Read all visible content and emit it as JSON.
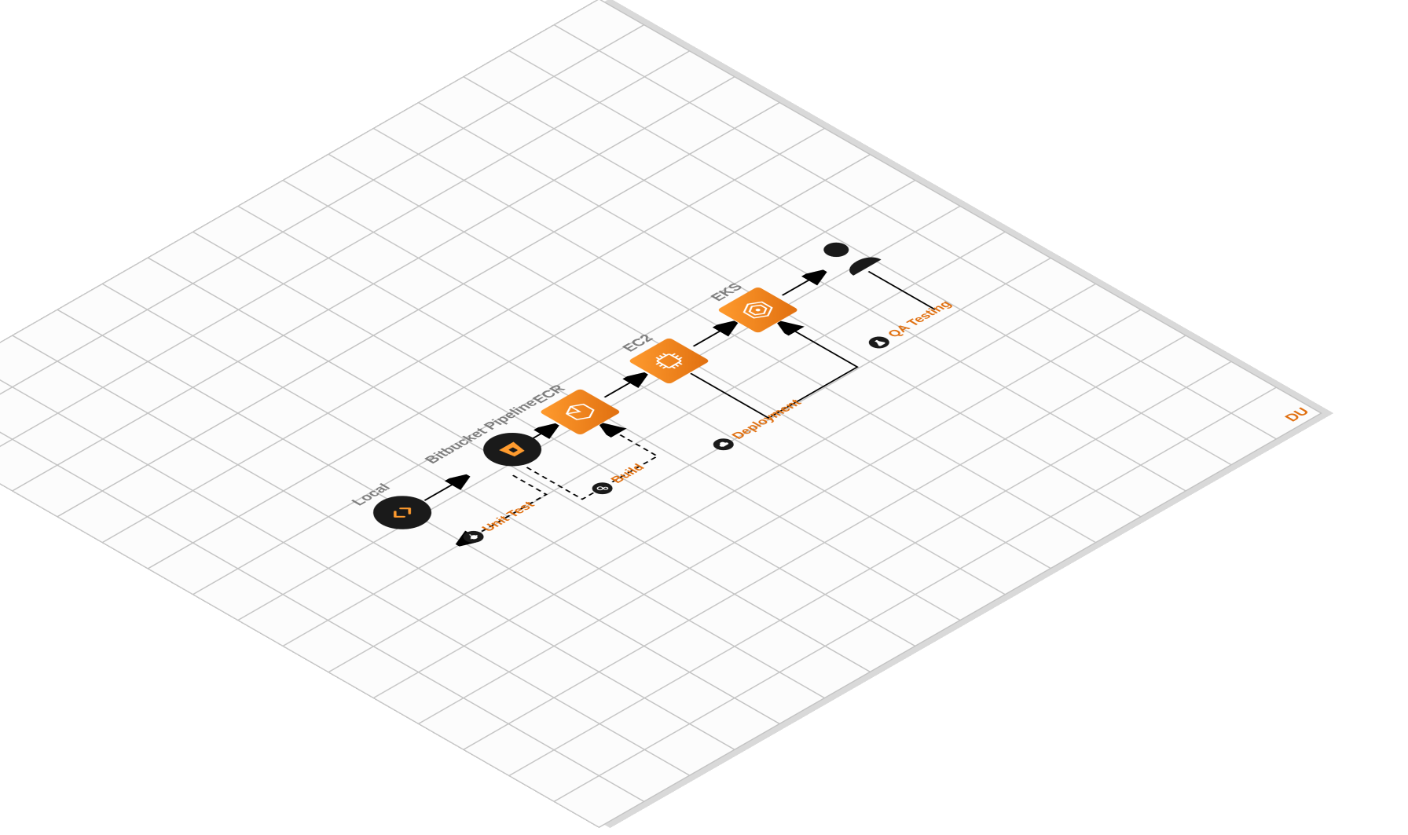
{
  "nodes": {
    "local": {
      "title": "Local"
    },
    "pipeline": {
      "title": "Bitbucket Pipeline"
    },
    "ecr": {
      "title": "ECR"
    },
    "ec2": {
      "title": "EC2"
    },
    "eks": {
      "title": "EKS"
    }
  },
  "steps": {
    "unit_test": {
      "label": "Unit Test"
    },
    "build": {
      "label": "Build"
    },
    "deployment": {
      "label": "Deployment"
    },
    "qa": {
      "label": "QA Testing"
    }
  },
  "watermark": "DU"
}
